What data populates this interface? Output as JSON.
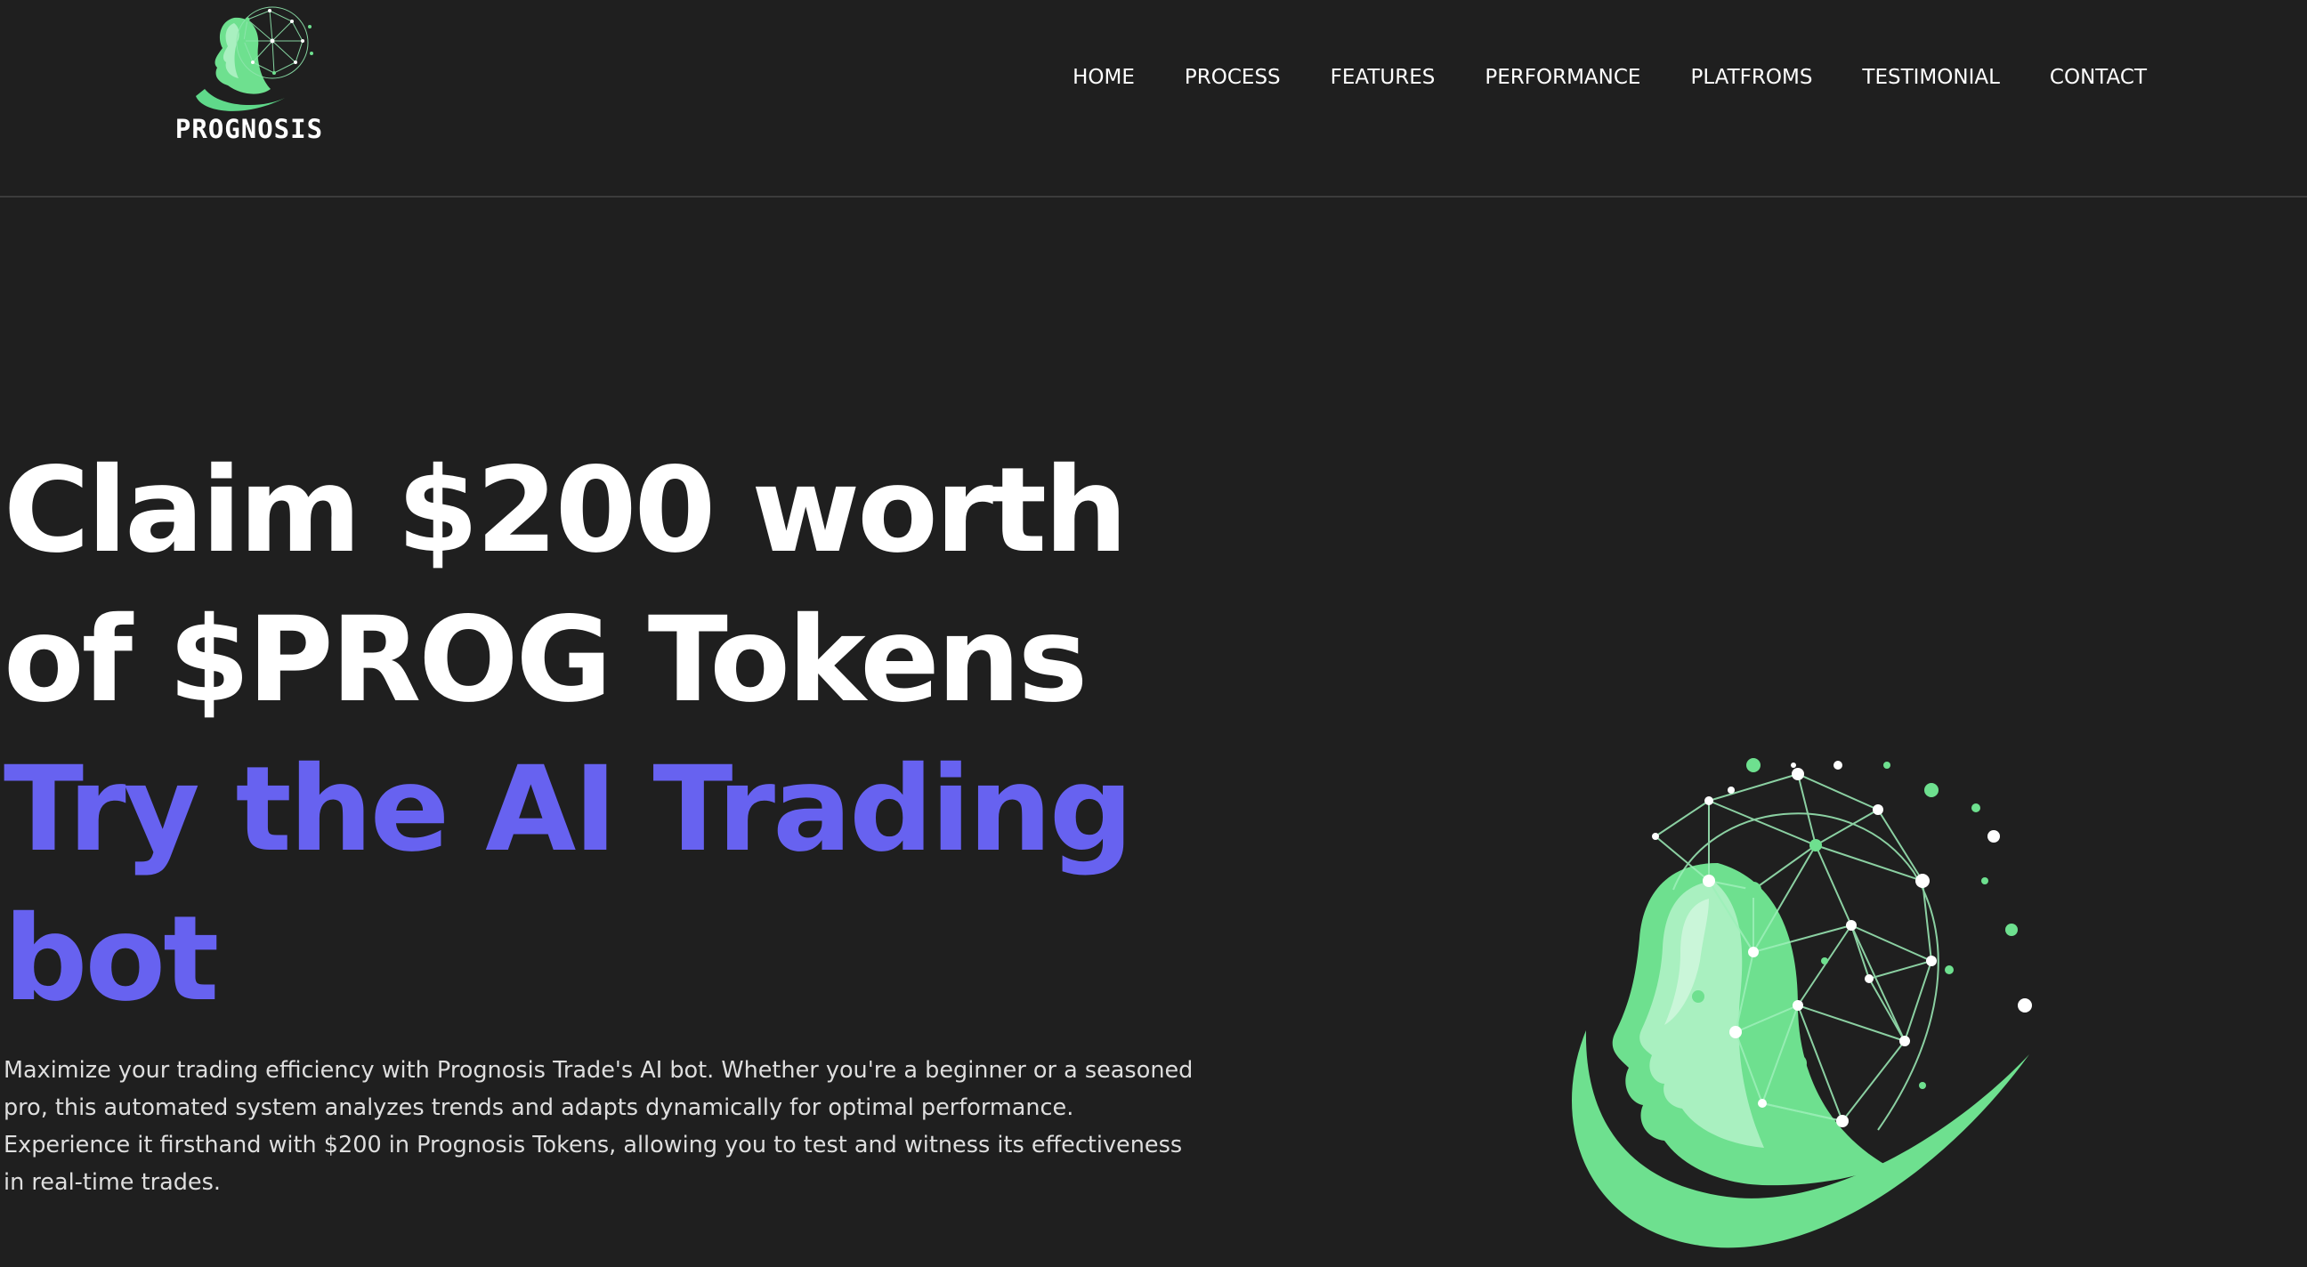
{
  "brand": {
    "name": "PROGNOSIS",
    "logo_icon": "ai-head-network-logo"
  },
  "nav": {
    "items": [
      {
        "label": "HOME"
      },
      {
        "label": "PROCESS"
      },
      {
        "label": "FEATURES"
      },
      {
        "label": "PERFORMANCE"
      },
      {
        "label": "PLATFROMS"
      },
      {
        "label": "TESTIMONIAL"
      },
      {
        "label": "CONTACT"
      }
    ]
  },
  "hero": {
    "title_line1": "Claim $200 worth",
    "title_line2": "of $PROG Tokens",
    "highlight_line1": "Try the AI Trading",
    "highlight_line2": "bot",
    "description": "Maximize your trading efficiency with Prognosis Trade's AI bot. Whether you're a beginner or a seasoned pro, this automated system analyzes trends and adapts dynamically for optimal performance. Experience it firsthand with $200 in Prognosis Tokens, allowing you to test and witness its effectiveness in real-time trades.",
    "illustration": "ai-head-network-illustration"
  },
  "colors": {
    "background": "#1f1f1f",
    "accent": "#6762f0",
    "brand_green": "#6ee08f",
    "text": "#ffffff",
    "divider": "#3c3c3c"
  }
}
